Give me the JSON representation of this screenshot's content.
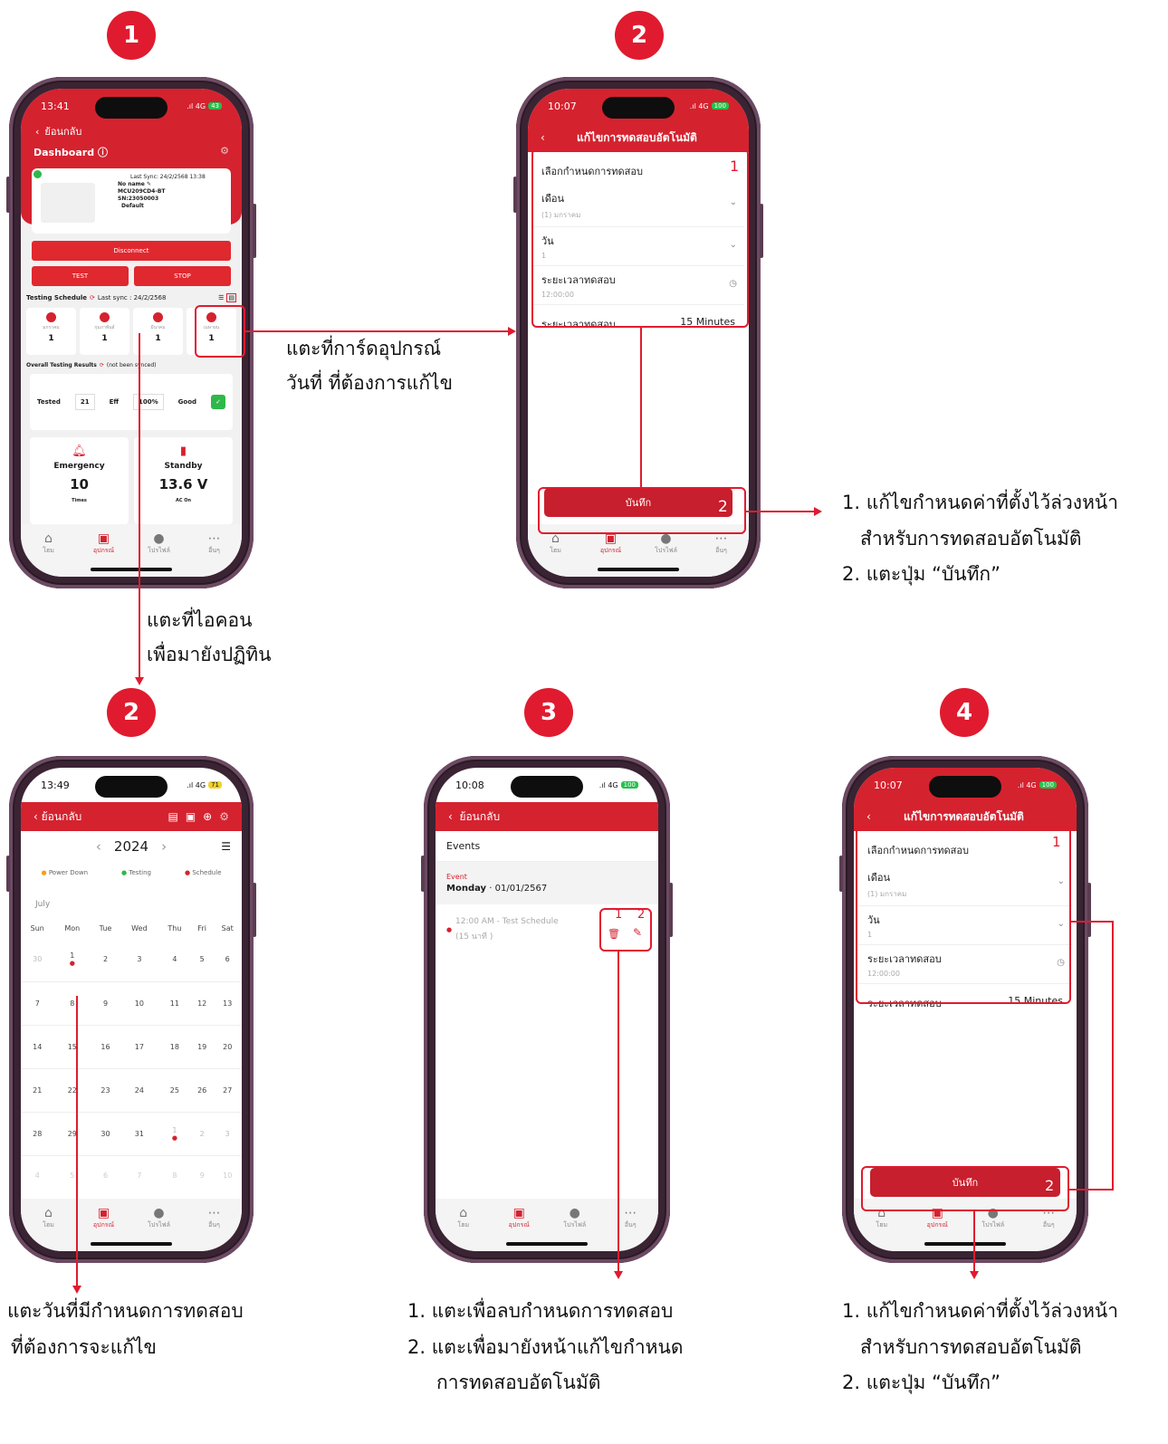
{
  "steps": {
    "s1": "1",
    "s2a": "2",
    "s2b": "2",
    "s3": "3",
    "s4": "4"
  },
  "p1": {
    "time": "13:41",
    "signal": ".ıl 4G",
    "battery": "43",
    "back": "ย้อนกลับ",
    "dashboard": "Dashboard",
    "last_sync": "Last Sync: 24/2/2568 13:38",
    "device_name": "No name",
    "model": "MCU209CD4-BT",
    "serial": "SN:23050003",
    "profile": "Default",
    "disconnect": "Disconnect",
    "test": "TEST",
    "stop": "STOP",
    "schedule_label": "Testing Schedule",
    "schedule_sync": "Last sync : 24/2/2568",
    "cards": [
      {
        "label": "มกราคม",
        "value": "1"
      },
      {
        "label": "กุมภาพันธ์",
        "value": "1"
      },
      {
        "label": "มีนาคม",
        "value": "1"
      },
      {
        "label": "เมษายน",
        "value": "1"
      }
    ],
    "overall_label": "Overall Testing Results",
    "overall_note": "(not been synced)",
    "tested": "Tested",
    "tested_val": "21",
    "eff": "Eff",
    "eff_val": "100%",
    "good": "Good",
    "emergency": "Emergency",
    "emergency_val": "10",
    "emergency_unit": "Times",
    "standby": "Standby",
    "standby_val": "13.6 V",
    "standby_unit": "AC On"
  },
  "tabs": [
    "โฮม",
    "อุปกรณ์",
    "โปรไฟล์",
    "อื่นๆ"
  ],
  "form": {
    "time_a": "10:07",
    "signal": ".ıl 4G",
    "battery": "100",
    "title": "แก้ไขการทดสอบอัตโนมัติ",
    "section": "เลือกกำหนดการทดสอบ",
    "num1": "1",
    "month_label": "เดือน",
    "month_val": "(1) มกราคม",
    "day_label": "วัน",
    "day_val": "1",
    "time_label": "ระยะเวลาทดสอบ",
    "time_val": "12:00:00",
    "duration_label": "ระยะเวลาทดสอบ",
    "duration_val": "15 Minutes",
    "save": "บันทึก",
    "num2": "2"
  },
  "cal": {
    "time": "13:49",
    "signal": ".ıl 4G",
    "battery": "71",
    "back": "ย้อนกลับ",
    "year": "2024",
    "legend": [
      "Power Down",
      "Testing",
      "Schedule"
    ],
    "legend_colors": [
      "#f0a020",
      "#2fb84a",
      "#d5222f"
    ],
    "month": "July",
    "weekdays": [
      "Sun",
      "Mon",
      "Tue",
      "Wed",
      "Thu",
      "Fri",
      "Sat"
    ],
    "weeks": [
      [
        "30",
        "1",
        "2",
        "3",
        "4",
        "5",
        "6"
      ],
      [
        "7",
        "8",
        "9",
        "10",
        "11",
        "12",
        "13"
      ],
      [
        "14",
        "15",
        "16",
        "17",
        "18",
        "19",
        "20"
      ],
      [
        "21",
        "22",
        "23",
        "24",
        "25",
        "26",
        "27"
      ],
      [
        "28",
        "29",
        "30",
        "31",
        "1",
        "2",
        "3"
      ],
      [
        "4",
        "5",
        "6",
        "7",
        "8",
        "9",
        "10"
      ]
    ]
  },
  "events": {
    "time": "10:08",
    "signal": ".ıl 4G",
    "battery": "100",
    "back": "ย้อนกลับ",
    "title": "Events",
    "event_label": "Event",
    "day": "Monday",
    "date": "01/01/2567",
    "item": "12:00 AM - Test Schedule",
    "item_sub": "(15 นาที )",
    "n1": "1",
    "n2": "2"
  },
  "annotations": {
    "a1_l1": "แตะที่การ์ดอุปกรณ์",
    "a1_l2": "วันที่ ที่ต้องการแก้ไข",
    "a2_l1": "แตะที่ไอคอน",
    "a2_l2": "เพื่อมายังปฏิทิน",
    "r1_l1": "1. แก้ไขกำหนดค่าที่ตั้งไว้ล่วงหน้า",
    "r1_l2": "สำหรับการทดสอบอัตโนมัติ",
    "r1_l3": "2. แตะปุ่ม  “บันทึก”",
    "b1_l1": "แตะวันที่มีกำหนดการทดสอบ",
    "b1_l2": "ที่ต้องการจะแก้ไข",
    "b2_l1": "1.   แตะเพื่อลบกำหนดการทดสอบ",
    "b2_l2": "2.  แตะเพื่อมายังหน้าแก้ไขกำหนด",
    "b2_l3": "การทดสอบอัตโนมัติ",
    "b3_l1": "1. แก้ไขกำหนดค่าที่ตั้งไว้ล่วงหน้า",
    "b3_l2": "สำหรับการทดสอบอัตโนมัติ",
    "b3_l3": "2. แตะปุ่ม  “บันทึก”"
  }
}
